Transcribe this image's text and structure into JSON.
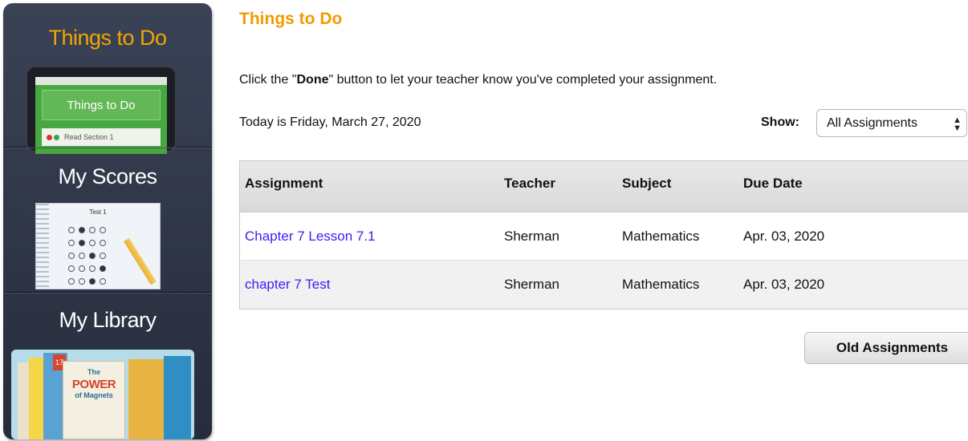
{
  "sidebar": {
    "items": [
      {
        "label": "Things to Do",
        "thumb": {
          "card": "Things to Do",
          "line": "Read Section 1"
        }
      },
      {
        "label": "My Scores",
        "thumb": {
          "sheet_title": "Test 1"
        }
      },
      {
        "label": "My Library",
        "thumb": {
          "line1": "The",
          "line2": "POWER",
          "line3": "of Magnets",
          "badge": "17"
        }
      }
    ],
    "accent": "#f2a500"
  },
  "main": {
    "title": "Things to Do",
    "instructions": {
      "before": "Click the \"",
      "bold": "Done",
      "after": "\" button to let your teacher know you've completed your assignment."
    },
    "today": "Today is Friday, March 27, 2020",
    "show": {
      "label": "Show:",
      "value": "All Assignments"
    },
    "table": {
      "headers": [
        "Assignment",
        "Teacher",
        "Subject",
        "Due Date"
      ],
      "rows": [
        [
          "Chapter 7 Lesson 7.1",
          "Sherman",
          "Mathematics",
          "Apr. 03, 2020"
        ],
        [
          "chapter 7 Test",
          "Sherman",
          "Mathematics",
          "Apr. 03, 2020"
        ]
      ]
    },
    "old_assignments_label": "Old Assignments"
  },
  "colors": {
    "title": "#f29b00",
    "link": "#3d1df0"
  }
}
